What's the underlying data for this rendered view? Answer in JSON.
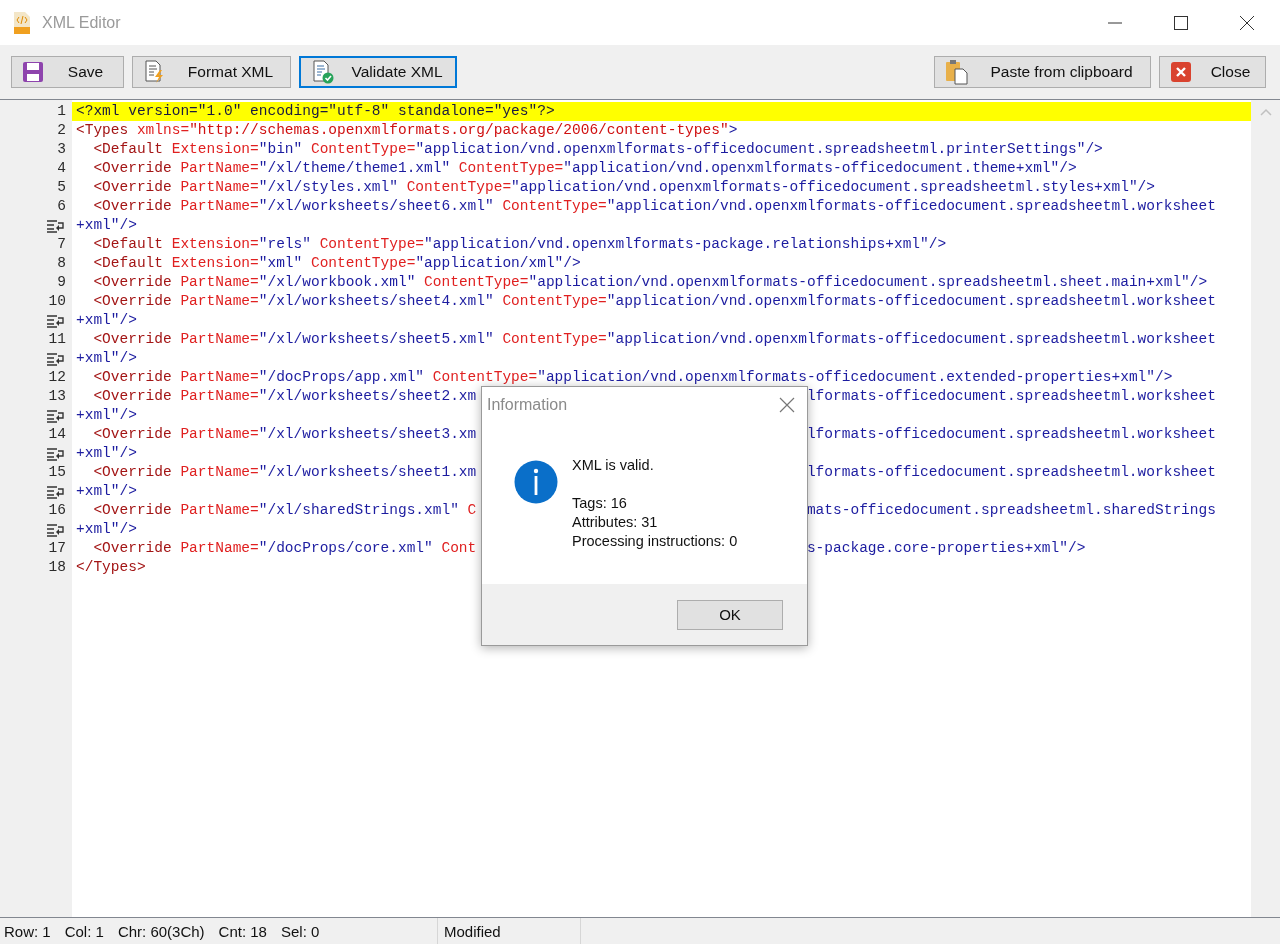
{
  "window": {
    "title": "XML Editor"
  },
  "toolbar": [
    {
      "kind": "save",
      "label": "Save",
      "focused": false
    },
    {
      "kind": "format",
      "label": "Format XML",
      "focused": false
    },
    {
      "kind": "validate",
      "label": "Validate XML",
      "focused": true
    },
    {
      "kind": "paste",
      "label": "Paste from clipboard",
      "focused": false
    },
    {
      "kind": "close",
      "label": "Close",
      "focused": false
    }
  ],
  "editor": {
    "lines": [
      {
        "number": "1",
        "highlighted": true,
        "segments": [
          {
            "kind": "pi",
            "text": "<?xml version=\"1.0\" encoding=\"utf-8\" standalone=\"yes\"?>"
          }
        ]
      },
      {
        "number": "2",
        "highlighted": false,
        "segments": [
          {
            "kind": "tag",
            "text": "<Types"
          },
          {
            "kind": "attr",
            "text": " xmlns="
          },
          {
            "kind": "ns",
            "text": "\"http://schemas.openxmlformats.org/package/2006/content-types\""
          },
          {
            "kind": "value",
            "text": ">"
          }
        ]
      },
      {
        "number": "3",
        "highlighted": false,
        "segments": [
          {
            "kind": "tag",
            "text": "  <Default"
          },
          {
            "kind": "attr",
            "text": " Extension="
          },
          {
            "kind": "value",
            "text": "\"bin\""
          },
          {
            "kind": "attr",
            "text": " ContentType="
          },
          {
            "kind": "value",
            "text": "\"application/vnd.openxmlformats-officedocument.spreadsheetml.printerSettings\"/>"
          }
        ]
      },
      {
        "number": "4",
        "highlighted": false,
        "segments": [
          {
            "kind": "tag",
            "text": "  <Override"
          },
          {
            "kind": "attr",
            "text": " PartName="
          },
          {
            "kind": "value",
            "text": "\"/xl/theme/theme1.xml\""
          },
          {
            "kind": "attr",
            "text": " ContentType="
          },
          {
            "kind": "value",
            "text": "\"application/vnd.openxmlformats-officedocument.theme+xml\"/>"
          }
        ]
      },
      {
        "number": "5",
        "highlighted": false,
        "segments": [
          {
            "kind": "tag",
            "text": "  <Override"
          },
          {
            "kind": "attr",
            "text": " PartName="
          },
          {
            "kind": "value",
            "text": "\"/xl/styles.xml\""
          },
          {
            "kind": "attr",
            "text": " ContentType="
          },
          {
            "kind": "value",
            "text": "\"application/vnd.openxmlformats-officedocument.spreadsheetml.styles+xml\"/>"
          }
        ]
      },
      {
        "number": "6",
        "highlighted": false,
        "segments": [
          {
            "kind": "tag",
            "text": "  <Override"
          },
          {
            "kind": "attr",
            "text": " PartName="
          },
          {
            "kind": "value",
            "text": "\"/xl/worksheets/sheet6.xml\""
          },
          {
            "kind": "attr",
            "text": " ContentType="
          },
          {
            "kind": "value",
            "text": "\"application/vnd.openxmlformats-officedocument.spreadsheetml.worksheet"
          }
        ],
        "wrap": [
          {
            "kind": "value",
            "text": "+xml\"/>"
          }
        ]
      },
      {
        "number": "7",
        "highlighted": false,
        "segments": [
          {
            "kind": "tag",
            "text": "  <Default"
          },
          {
            "kind": "attr",
            "text": " Extension="
          },
          {
            "kind": "value",
            "text": "\"rels\""
          },
          {
            "kind": "attr",
            "text": " ContentType="
          },
          {
            "kind": "value",
            "text": "\"application/vnd.openxmlformats-package.relationships+xml\"/>"
          }
        ]
      },
      {
        "number": "8",
        "highlighted": false,
        "segments": [
          {
            "kind": "tag",
            "text": "  <Default"
          },
          {
            "kind": "attr",
            "text": " Extension="
          },
          {
            "kind": "value",
            "text": "\"xml\""
          },
          {
            "kind": "attr",
            "text": " ContentType="
          },
          {
            "kind": "value",
            "text": "\"application/xml\"/>"
          }
        ]
      },
      {
        "number": "9",
        "highlighted": false,
        "segments": [
          {
            "kind": "tag",
            "text": "  <Override"
          },
          {
            "kind": "attr",
            "text": " PartName="
          },
          {
            "kind": "value",
            "text": "\"/xl/workbook.xml\""
          },
          {
            "kind": "attr",
            "text": " ContentType="
          },
          {
            "kind": "value",
            "text": "\"application/vnd.openxmlformats-officedocument.spreadsheetml.sheet.main+xml\"/>"
          }
        ]
      },
      {
        "number": "10",
        "highlighted": false,
        "segments": [
          {
            "kind": "tag",
            "text": "  <Override"
          },
          {
            "kind": "attr",
            "text": " PartName="
          },
          {
            "kind": "value",
            "text": "\"/xl/worksheets/sheet4.xml\""
          },
          {
            "kind": "attr",
            "text": " ContentType="
          },
          {
            "kind": "value",
            "text": "\"application/vnd.openxmlformats-officedocument.spreadsheetml.worksheet"
          }
        ],
        "wrap": [
          {
            "kind": "value",
            "text": "+xml\"/>"
          }
        ]
      },
      {
        "number": "11",
        "highlighted": false,
        "segments": [
          {
            "kind": "tag",
            "text": "  <Override"
          },
          {
            "kind": "attr",
            "text": " PartName="
          },
          {
            "kind": "value",
            "text": "\"/xl/worksheets/sheet5.xml\""
          },
          {
            "kind": "attr",
            "text": " ContentType="
          },
          {
            "kind": "value",
            "text": "\"application/vnd.openxmlformats-officedocument.spreadsheetml.worksheet"
          }
        ],
        "wrap": [
          {
            "kind": "value",
            "text": "+xml\"/>"
          }
        ]
      },
      {
        "number": "12",
        "highlighted": false,
        "segments": [
          {
            "kind": "tag",
            "text": "  <Override"
          },
          {
            "kind": "attr",
            "text": " PartName="
          },
          {
            "kind": "value",
            "text": "\"/docProps/app.xml\""
          },
          {
            "kind": "attr",
            "text": " ContentType="
          },
          {
            "kind": "value",
            "text": "\"application/vnd.openxmlformats-officedocument.extended-properties+xml\"/>"
          }
        ]
      },
      {
        "number": "13",
        "highlighted": false,
        "segments": [
          {
            "kind": "tag",
            "text": "  <Override"
          },
          {
            "kind": "attr",
            "text": " PartName="
          },
          {
            "kind": "value",
            "text": "\"/xl/worksheets/sheet2.xm"
          },
          {
            "kind": "gap"
          },
          {
            "kind": "value",
            "text": "lformats-officedocument.spreadsheetml.worksheet"
          }
        ],
        "wrap": [
          {
            "kind": "value",
            "text": "+xml\"/>"
          }
        ]
      },
      {
        "number": "14",
        "highlighted": false,
        "segments": [
          {
            "kind": "tag",
            "text": "  <Override"
          },
          {
            "kind": "attr",
            "text": " PartName="
          },
          {
            "kind": "value",
            "text": "\"/xl/worksheets/sheet3.xm"
          },
          {
            "kind": "gap"
          },
          {
            "kind": "value",
            "text": "lformats-officedocument.spreadsheetml.worksheet"
          }
        ],
        "wrap": [
          {
            "kind": "value",
            "text": "+xml\"/>"
          }
        ]
      },
      {
        "number": "15",
        "highlighted": false,
        "segments": [
          {
            "kind": "tag",
            "text": "  <Override"
          },
          {
            "kind": "attr",
            "text": " PartName="
          },
          {
            "kind": "value",
            "text": "\"/xl/worksheets/sheet1.xm"
          },
          {
            "kind": "gap"
          },
          {
            "kind": "value",
            "text": "lformats-officedocument.spreadsheetml.worksheet"
          }
        ],
        "wrap": [
          {
            "kind": "value",
            "text": "+xml\"/>"
          }
        ]
      },
      {
        "number": "16",
        "highlighted": false,
        "segments": [
          {
            "kind": "tag",
            "text": "  <Override"
          },
          {
            "kind": "attr",
            "text": " PartName="
          },
          {
            "kind": "value",
            "text": "\"/xl/sharedStrings.xml\""
          },
          {
            "kind": "attr",
            "text": " C"
          },
          {
            "kind": "gap"
          },
          {
            "kind": "value",
            "text": "mats-officedocument.spreadsheetml.sharedStrings"
          }
        ],
        "wrap": [
          {
            "kind": "value",
            "text": "+xml\"/>"
          }
        ]
      },
      {
        "number": "17",
        "highlighted": false,
        "segments": [
          {
            "kind": "tag",
            "text": "  <Override"
          },
          {
            "kind": "attr",
            "text": " PartName="
          },
          {
            "kind": "value",
            "text": "\"/docProps/core.xml\""
          },
          {
            "kind": "attr",
            "text": " Cont"
          },
          {
            "kind": "gap"
          },
          {
            "kind": "value",
            "text": "s-package.core-properties+xml\"/>"
          }
        ]
      },
      {
        "number": "18",
        "highlighted": false,
        "segments": [
          {
            "kind": "tag",
            "text": "</Types>"
          }
        ]
      }
    ]
  },
  "dialog": {
    "title": "Information",
    "message": "XML is valid.",
    "details": [
      "Tags: 16",
      "Attributes: 31",
      "Processing instructions: 0"
    ],
    "button": "OK"
  },
  "status_bar": {
    "fields": [
      "Row: 1",
      "Col: 1",
      "Chr: 60(3Ch)",
      "Cnt: 18",
      "Sel: 0"
    ],
    "state": "Modified"
  }
}
